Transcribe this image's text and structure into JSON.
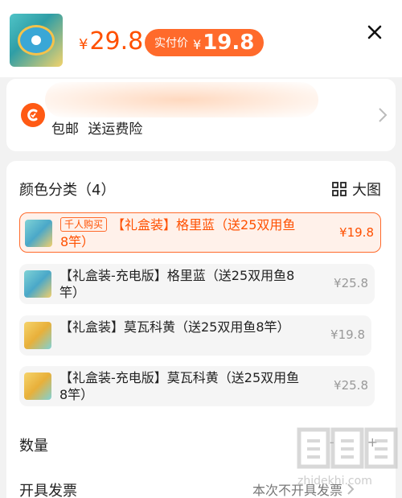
{
  "header": {
    "price_symbol": "¥",
    "price": "29.8",
    "badge_label": "实付价",
    "badge_symbol": "¥",
    "badge_price": "19.8",
    "close_icon": "close-icon"
  },
  "shipping": {
    "services": "包邮 送运费险",
    "icon": "shipping-icon"
  },
  "sku": {
    "title": "颜色分类（4）",
    "big_image_label": "大图",
    "options": [
      {
        "tag": "千人购买",
        "label": "【礼盒装】格里蓝（送25双用鱼8竿）",
        "price": "¥19.8",
        "selected": true
      },
      {
        "tag": "",
        "label": "【礼盒装-充电版】格里蓝（送25双用鱼8竿）",
        "price": "¥25.8",
        "selected": false
      },
      {
        "tag": "",
        "label": "【礼盒装】莫瓦科黄（送25双用鱼8竿）",
        "price": "¥19.8",
        "selected": false
      },
      {
        "tag": "",
        "label": "【礼盒装-充电版】莫瓦科黄（送25双用鱼8竿）",
        "price": "¥25.8",
        "selected": false
      }
    ]
  },
  "quantity": {
    "label": "数量",
    "minus": "-",
    "plus": "+"
  },
  "invoice": {
    "label": "开具发票",
    "value": "本次不开具发票"
  },
  "watermark": {
    "text": "zhidekhi.com"
  },
  "colors": {
    "accent": "#ff5000",
    "badge_bg": "#ff6a2b"
  }
}
